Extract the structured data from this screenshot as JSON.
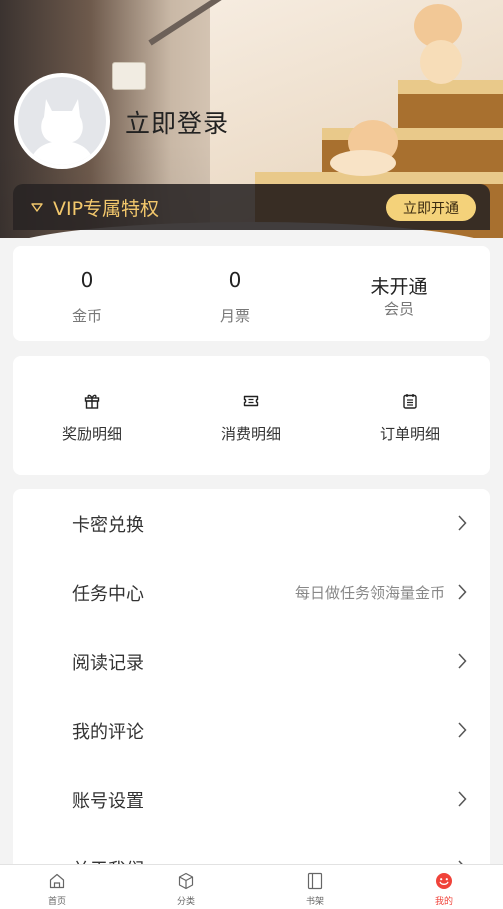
{
  "header": {
    "login_text": "立即登录",
    "vip_label": "VIP专属特权",
    "vip_button": "立即开通"
  },
  "stats": [
    {
      "value": "0",
      "label": "金币"
    },
    {
      "value": "0",
      "label": "月票"
    },
    {
      "value": "未开通",
      "label": "会员"
    }
  ],
  "shortcuts": [
    {
      "label": "奖励明细",
      "icon": "gift-icon"
    },
    {
      "label": "消费明细",
      "icon": "ticket-icon"
    },
    {
      "label": "订单明细",
      "icon": "order-list-icon"
    }
  ],
  "menu": [
    {
      "label": "卡密兑换",
      "hint": ""
    },
    {
      "label": "任务中心",
      "hint": "每日做任务领海量金币"
    },
    {
      "label": "阅读记录",
      "hint": ""
    },
    {
      "label": "我的评论",
      "hint": ""
    },
    {
      "label": "账号设置",
      "hint": ""
    },
    {
      "label": "关于我们",
      "hint": ""
    }
  ],
  "tabbar": [
    {
      "label": "首页",
      "icon": "home-icon"
    },
    {
      "label": "分类",
      "icon": "category-icon"
    },
    {
      "label": "书架",
      "icon": "bookshelf-icon"
    },
    {
      "label": "我的",
      "icon": "smile-icon",
      "active": true
    }
  ],
  "colors": {
    "accent": "#f0433a",
    "vip_gold": "#f3c86c",
    "vip_button_bg": "#f4d27a"
  }
}
